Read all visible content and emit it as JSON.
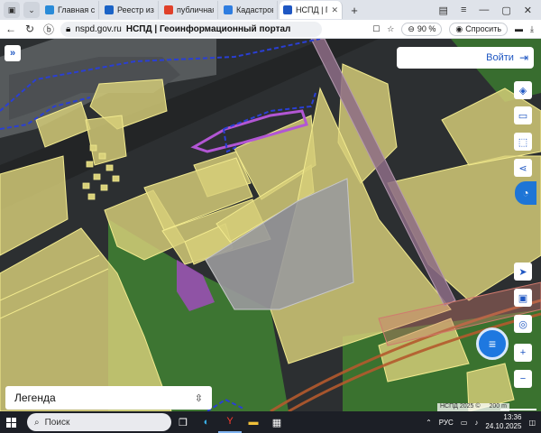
{
  "browser": {
    "tabs": [
      {
        "title": "Главная стр",
        "active": false,
        "favicon_color": "#2a8bd8"
      },
      {
        "title": "Реестр изве",
        "active": false,
        "favicon_color": "#1b63c6"
      },
      {
        "title": "публичная к",
        "active": false,
        "favicon_color": "#e0402a"
      },
      {
        "title": "Кадастрове",
        "active": false,
        "favicon_color": "#2f7de0"
      },
      {
        "title": "НСПД | Ге",
        "active": true,
        "favicon_color": "#1f57c3"
      }
    ],
    "url": "nspd.gov.ru",
    "page_title": "НСПД | Геоинформационный портал",
    "zoom": "90 %",
    "ask_label": "Спросить"
  },
  "map": {
    "login_label": "Войти",
    "legend_label": "Легенда",
    "attribution": "НСПД 2025 ©",
    "scale_label": "200 m",
    "right_controls": [
      "layers-icon",
      "ruler-icon",
      "select-area-icon",
      "share-icon"
    ],
    "bottom_controls": [
      "locate-icon",
      "basemap-icon",
      "pin-search-icon",
      "zoom-in-icon",
      "zoom-out-icon"
    ],
    "colors": {
      "parcel_fill": "#d8d07a",
      "parcel_stroke": "#f2ea8e",
      "built_fill": "#9a9a9c",
      "road_stroke": "#b45a2e",
      "boundary_dash": "#2a3fd4",
      "purple_zone": "#a44bc2",
      "vegetation": "#3f7d33"
    }
  },
  "taskbar": {
    "search_placeholder": "Поиск",
    "language": "РУС",
    "time": "13:36",
    "date": "24.10.2025"
  }
}
